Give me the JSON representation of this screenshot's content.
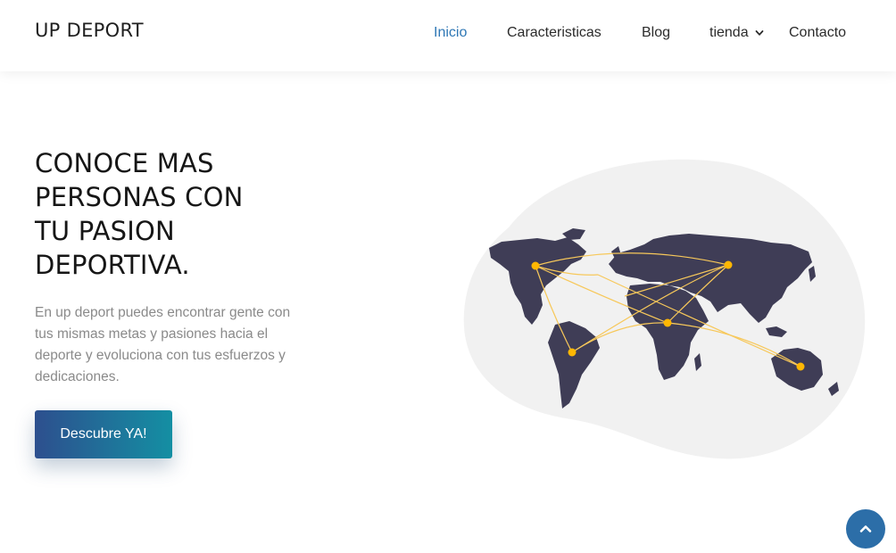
{
  "header": {
    "brand": "UP DEPORT",
    "nav": [
      {
        "label": "Inicio",
        "active": true
      },
      {
        "label": "Caracteristicas",
        "active": false
      },
      {
        "label": "Blog",
        "active": false
      },
      {
        "label": "tienda",
        "active": false,
        "dropdown": true
      },
      {
        "label": "Contacto",
        "active": false
      }
    ]
  },
  "hero": {
    "title_lines": [
      "CONOCE MAS",
      "PERSONAS CON",
      "TU PASION",
      "DEPORTIVA."
    ],
    "description": "En up deport puedes encontrar gente con tus mismas metas y pasiones hacia el deporte y evoluciona con tus esfuerzos y dedicaciones.",
    "cta_label": "Descubre YA!"
  },
  "illustration": {
    "name": "world-map-connections",
    "colors": {
      "blob": "#f1f1f1",
      "land": "#3f3d56",
      "point": "#ffb703",
      "line": "#f7c85a"
    }
  },
  "colors": {
    "accent": "#2e77b5",
    "cta_gradient_start": "#2d4f8e",
    "cta_gradient_end": "#148fa3",
    "scroll_button": "#2c6ea8"
  },
  "icons": {
    "dropdown": "chevron-down-icon",
    "scroll_top": "chevron-up-icon"
  }
}
